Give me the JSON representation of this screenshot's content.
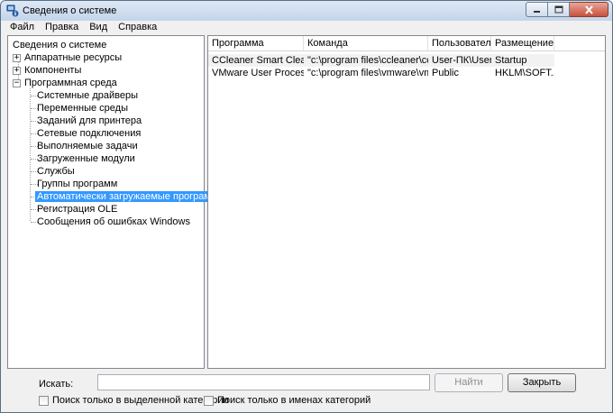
{
  "window": {
    "title": "Сведения о системе"
  },
  "menu": [
    "Файл",
    "Правка",
    "Вид",
    "Справка"
  ],
  "tree": {
    "root": "Сведения о системе",
    "top_items": [
      {
        "label": "Аппаратные ресурсы",
        "expander": "+"
      },
      {
        "label": "Компоненты",
        "expander": "+"
      },
      {
        "label": "Программная среда",
        "expander": "−"
      }
    ],
    "children": [
      "Системные драйверы",
      "Переменные среды",
      "Заданий для принтера",
      "Сетевые подключения",
      "Выполняемые задачи",
      "Загруженные модули",
      "Службы",
      "Группы программ",
      "Автоматически загружаемые программы",
      "Регистрация OLE",
      "Сообщения об ошибках Windows"
    ],
    "selected_child": "Автоматически загружаемые программы"
  },
  "list": {
    "columns": [
      "Программа",
      "Команда",
      "Пользователь",
      "Размещение"
    ],
    "rows": [
      [
        "CCleaner Smart Cleani...",
        "\"c:\\program files\\ccleaner\\ccle...",
        "User-ПК\\User",
        "Startup"
      ],
      [
        "VMware User Process",
        "\"c:\\program files\\vmware\\vmw...",
        "Public",
        "HKLM\\SOFT..."
      ]
    ]
  },
  "search": {
    "label": "Искать:",
    "value": ""
  },
  "buttons": {
    "find": "Найти",
    "close": "Закрыть"
  },
  "checkboxes": {
    "selected_category": "Поиск только в выделенной категории",
    "category_names": "Поиск только в именах категорий"
  },
  "colors": {
    "selection": "#3399ff",
    "title_bar": "#c4d5ea"
  }
}
